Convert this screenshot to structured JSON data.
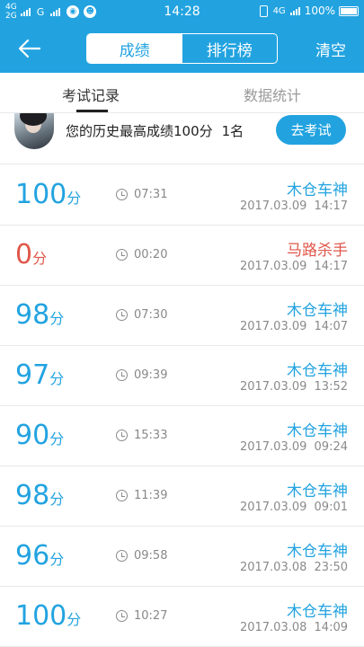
{
  "status_bar": {
    "net_top": "4G",
    "net_bottom": "2G",
    "carrier": "G",
    "time": "14:28",
    "net_right": "4G",
    "battery": "100%"
  },
  "header": {
    "tab_scores": "成绩",
    "tab_ranking": "排行榜",
    "clear_label": "清空"
  },
  "tabs": {
    "records": "考试记录",
    "stats": "数据统计"
  },
  "best": {
    "text": "您的历史最高成绩100分",
    "rank": "1名",
    "button": "去考试"
  },
  "records": [
    {
      "score": "100",
      "unit": "分",
      "duration": "07:31",
      "title": "木仓车神",
      "date": "2017.03.09  14:17",
      "level": "pass"
    },
    {
      "score": "0",
      "unit": "分",
      "duration": "00:20",
      "title": "马路杀手",
      "date": "2017.03.09  14:17",
      "level": "fail"
    },
    {
      "score": "98",
      "unit": "分",
      "duration": "07:30",
      "title": "木仓车神",
      "date": "2017.03.09  14:07",
      "level": "pass"
    },
    {
      "score": "97",
      "unit": "分",
      "duration": "09:39",
      "title": "木仓车神",
      "date": "2017.03.09  13:52",
      "level": "pass"
    },
    {
      "score": "90",
      "unit": "分",
      "duration": "15:33",
      "title": "木仓车神",
      "date": "2017.03.09  09:24",
      "level": "pass"
    },
    {
      "score": "98",
      "unit": "分",
      "duration": "11:39",
      "title": "木仓车神",
      "date": "2017.03.09  09:01",
      "level": "pass"
    },
    {
      "score": "96",
      "unit": "分",
      "duration": "09:58",
      "title": "木仓车神",
      "date": "2017.03.08  23:50",
      "level": "pass"
    },
    {
      "score": "100",
      "unit": "分",
      "duration": "10:27",
      "title": "木仓车神",
      "date": "2017.03.08  14:09",
      "level": "pass"
    }
  ],
  "colors": {
    "accent": "#22a3e0",
    "fail": "#e0574a"
  }
}
